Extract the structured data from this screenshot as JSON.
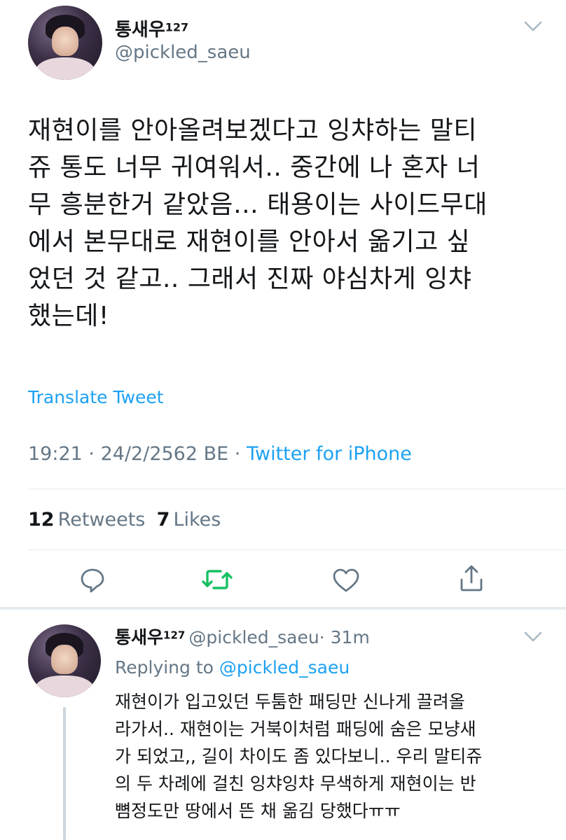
{
  "main_tweet": {
    "display_name": "통새우",
    "name_badge": "127",
    "handle": "@pickled_saeu",
    "text_lines": [
      "재현이를 안아올려보겠다고 잉챠하는 말티",
      "쥬 통도 너무 귀여워서.. 중간에 나 혼자 너",
      "무 흥분한거 같았음… 태용이는 사이드무대",
      "에서 본무대로 재현이를 안아서 옮기고 싶",
      "었던 것 같고.. 그래서 진짜 야심차게 잉챠",
      "했는데!"
    ],
    "translate_label": "Translate Tweet",
    "time": "19:21",
    "date": "24/2/2562 BE",
    "separator": "·",
    "source": "Twitter for iPhone",
    "retweets_count": "12",
    "retweets_label": "Retweets",
    "likes_count": "7",
    "likes_label": "Likes"
  },
  "reply_tweet": {
    "display_name": "통새우",
    "name_badge": "127",
    "handle": "@pickled_saeu",
    "age": "· 31m",
    "replying_label": "Replying to",
    "replying_handle": "@pickled_saeu",
    "text_lines": [
      "재현이가 입고있던 두툼한 패딩만 신나게 끌려올",
      "라가서.. 재현이는 거북이처럼 패딩에 숨은 모냥새",
      "가 되었고,, 길이 차이도 좀 있다보니.. 우리 말티쥬",
      "의 두 차례에 걸친 잉챠잉챠 무색하게 재현이는 반",
      "뼘정도만 땅에서 뜬 채 옮김 당했다ㅠㅠ"
    ]
  },
  "icons": [
    "chevron-down-icon",
    "reply-icon",
    "retweet-icon",
    "like-icon",
    "share-icon"
  ],
  "colors": {
    "link": "#1da1f2",
    "retweet_active": "#17bf63",
    "secondary_text": "#657786",
    "icon_gray": "#657786"
  }
}
